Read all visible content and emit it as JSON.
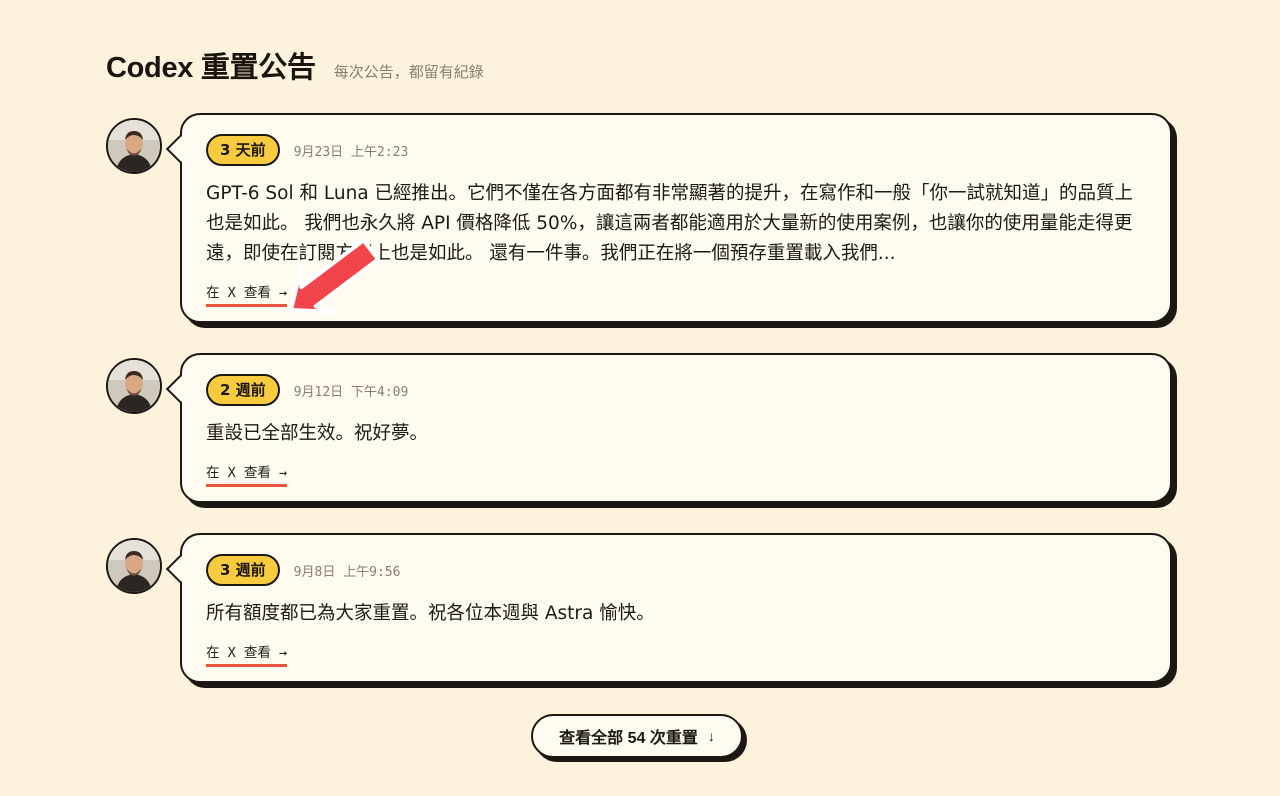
{
  "header": {
    "title": "Codex 重置公告",
    "subtitle": "每次公告，都留有紀錄"
  },
  "entries": [
    {
      "badge": "3 天前",
      "time": "9月23日 上午2:23",
      "text": "GPT-6 Sol 和 Luna 已經推出。它們不僅在各方面都有非常顯著的提升，在寫作和一般「你一試就知道」的品質上也是如此。 我們也永久將 API 價格降低 50%，讓這兩者都能適用於大量新的使用案例，也讓你的使用量能走得更遠，即使在訂閱方案上也是如此。 還有一件事。我們正在將一個預存重置載入我們...",
      "link": "在 X 查看 →"
    },
    {
      "badge": "2 週前",
      "time": "9月12日 下午4:09",
      "text": "重設已全部生效。祝好夢。",
      "link": "在 X 查看 →"
    },
    {
      "badge": "3 週前",
      "time": "9月8日 上午9:56",
      "text": "所有額度都已為大家重置。祝各位本週與 Astra 愉快。",
      "link": "在 X 查看 →"
    }
  ],
  "more_button": {
    "label": "查看全部 54 次重置",
    "icon": "↓"
  },
  "colors": {
    "background": "#fdf2dc",
    "card": "#fffbf0",
    "badge": "#f8cb3e",
    "link_underline": "#e8533a",
    "annotation_arrow": "#f2444c"
  }
}
